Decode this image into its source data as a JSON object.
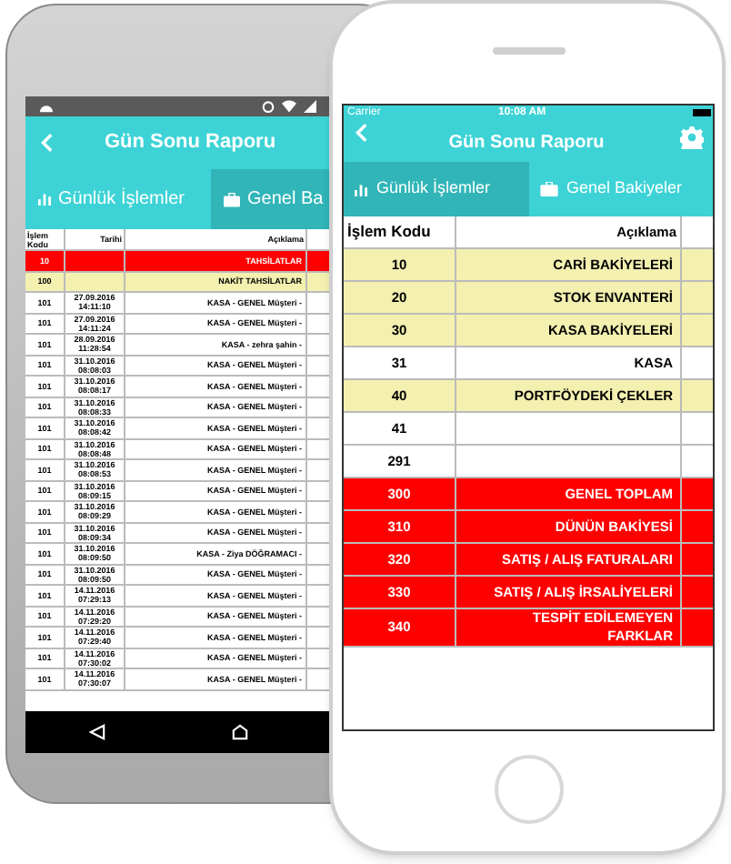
{
  "left_phone": {
    "header": {
      "title": "Gün Sonu Raporu"
    },
    "tabs": [
      {
        "label": "Günlük İşlemler",
        "selected": false
      },
      {
        "label": "Genel Ba",
        "selected": true
      }
    ],
    "table": {
      "columns": [
        "İşlem Kodu",
        "Tarihi",
        "Açıklama"
      ],
      "rows": [
        {
          "kind": "group",
          "code": "10",
          "date": "",
          "desc": "TAHSİLATLAR"
        },
        {
          "kind": "subgroup",
          "code": "100",
          "date": "",
          "desc": "NAKİT TAHSİLATLAR"
        },
        {
          "kind": "entry",
          "code": "101",
          "date": "27.09.2016 14:11:10",
          "desc": "KASA - GENEL Müşteri -"
        },
        {
          "kind": "entry",
          "code": "101",
          "date": "27.09.2016 14:11:24",
          "desc": "KASA - GENEL Müşteri -"
        },
        {
          "kind": "entry",
          "code": "101",
          "date": "28.09.2016 11:28:54",
          "desc": "KASA - zehra şahin -"
        },
        {
          "kind": "entry",
          "code": "101",
          "date": "31.10.2016 08:08:03",
          "desc": "KASA - GENEL Müşteri -"
        },
        {
          "kind": "entry",
          "code": "101",
          "date": "31.10.2016 08:08:17",
          "desc": "KASA - GENEL Müşteri -"
        },
        {
          "kind": "entry",
          "code": "101",
          "date": "31.10.2016 08:08:33",
          "desc": "KASA - GENEL Müşteri -"
        },
        {
          "kind": "entry",
          "code": "101",
          "date": "31.10.2016 08:08:42",
          "desc": "KASA - GENEL Müşteri -"
        },
        {
          "kind": "entry",
          "code": "101",
          "date": "31.10.2016 08:08:48",
          "desc": "KASA - GENEL Müşteri -"
        },
        {
          "kind": "entry",
          "code": "101",
          "date": "31.10.2016 08:08:53",
          "desc": "KASA - GENEL Müşteri -"
        },
        {
          "kind": "entry",
          "code": "101",
          "date": "31.10.2016 08:09:15",
          "desc": "KASA - GENEL Müşteri -"
        },
        {
          "kind": "entry",
          "code": "101",
          "date": "31.10.2016 08:09:29",
          "desc": "KASA - GENEL Müşteri -"
        },
        {
          "kind": "entry",
          "code": "101",
          "date": "31.10.2016 08:09:34",
          "desc": "KASA - GENEL Müşteri -"
        },
        {
          "kind": "entry",
          "code": "101",
          "date": "31.10.2016 08:09:50",
          "desc": "KASA - Ziya DÖĞRAMACI -"
        },
        {
          "kind": "entry",
          "code": "101",
          "date": "31.10.2016 08:09:50",
          "desc": "KASA - GENEL Müşteri -"
        },
        {
          "kind": "entry",
          "code": "101",
          "date": "14.11.2016 07:29:13",
          "desc": "KASA - GENEL Müşteri -"
        },
        {
          "kind": "entry",
          "code": "101",
          "date": "14.11.2016 07:29:20",
          "desc": "KASA - GENEL Müşteri -"
        },
        {
          "kind": "entry",
          "code": "101",
          "date": "14.11.2016 07:29:40",
          "desc": "KASA - GENEL Müşteri -"
        },
        {
          "kind": "entry",
          "code": "101",
          "date": "14.11.2016 07:30:02",
          "desc": "KASA - GENEL Müşteri -"
        },
        {
          "kind": "entry",
          "code": "101",
          "date": "14.11.2016 07:30:07",
          "desc": "KASA - GENEL Müşteri -"
        }
      ]
    }
  },
  "right_phone": {
    "status_bar": {
      "carrier": "Carrier",
      "time": "10:08 AM"
    },
    "header": {
      "title": "Gün Sonu Raporu"
    },
    "tabs": [
      {
        "label": "Günlük İşlemler",
        "selected": true
      },
      {
        "label": "Genel Bakiyeler",
        "selected": false
      }
    ],
    "table": {
      "columns": [
        "İşlem Kodu",
        "Açıklama"
      ],
      "rows": [
        {
          "kind": "subgroup",
          "code": "10",
          "desc": "CARİ BAKİYELERİ"
        },
        {
          "kind": "subgroup",
          "code": "20",
          "desc": "STOK ENVANTERİ"
        },
        {
          "kind": "subgroup",
          "code": "30",
          "desc": "KASA BAKİYELERİ"
        },
        {
          "kind": "entry",
          "code": "31",
          "desc": "KASA"
        },
        {
          "kind": "subgroup",
          "code": "40",
          "desc": "PORTFÖYDEKİ ÇEKLER"
        },
        {
          "kind": "entry",
          "code": "41",
          "desc": ""
        },
        {
          "kind": "entry",
          "code": "291",
          "desc": ""
        },
        {
          "kind": "group",
          "code": "300",
          "desc": "GENEL TOPLAM"
        },
        {
          "kind": "group",
          "code": "310",
          "desc": "DÜNÜN BAKİYESİ"
        },
        {
          "kind": "group",
          "code": "320",
          "desc": "SATIŞ / ALIŞ FATURALARI"
        },
        {
          "kind": "group",
          "code": "330",
          "desc": "SATIŞ / ALIŞ İRSALİYELERİ"
        },
        {
          "kind": "group",
          "code": "340",
          "desc": "TESPİT EDİLEMEYEN FARKLAR"
        }
      ]
    }
  }
}
